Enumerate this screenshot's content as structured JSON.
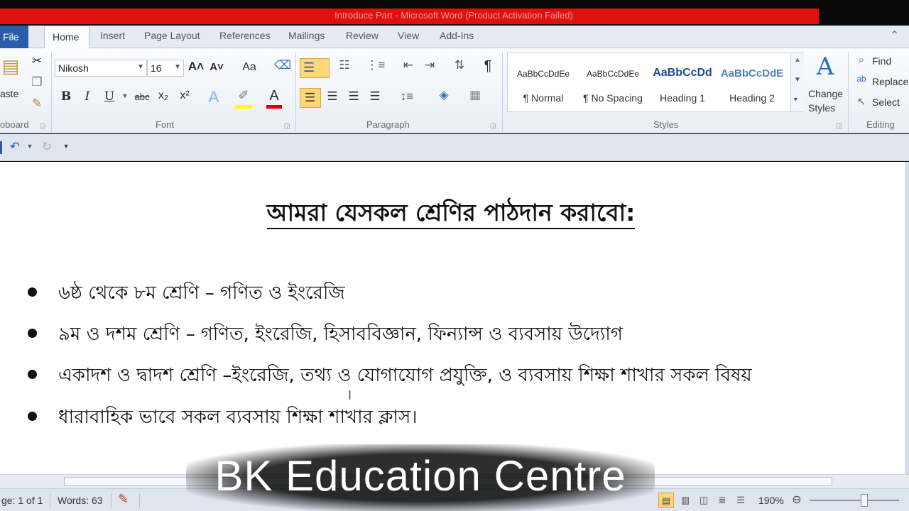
{
  "window": {
    "title": "Introduce Part - Microsoft Word (Product Activation Failed)"
  },
  "tabs": [
    "File",
    "Home",
    "Insert",
    "Page Layout",
    "References",
    "Mailings",
    "Review",
    "View",
    "Add-Ins"
  ],
  "clipboard": {
    "paste_label": "aste",
    "group_label": "oboard"
  },
  "font": {
    "name": "Nikosh",
    "size": "16",
    "group_label": "Font",
    "bold": "B",
    "italic": "I",
    "underline": "U",
    "strikethrough": "abc",
    "subscript": "x₂",
    "superscript": "x²",
    "grow": "A˄",
    "shrink": "A˅",
    "change_case": "Aa",
    "font_color_letter": "A"
  },
  "paragraph": {
    "group_label": "Paragraph",
    "pilcrow": "¶"
  },
  "styles": {
    "group_label": "Styles",
    "items": [
      {
        "preview": "AaBbCcDdEe",
        "name": "¶ Normal"
      },
      {
        "preview": "AaBbCcDdEe",
        "name": "¶ No Spacing"
      },
      {
        "preview": "AaBbCcDd",
        "name": "Heading 1"
      },
      {
        "preview": "AaBbCcDdE",
        "name": "Heading 2"
      }
    ],
    "change_styles_1": "Change",
    "change_styles_2": "Styles"
  },
  "editing": {
    "group_label": "Editing",
    "find": "Find",
    "replace": "Replace",
    "select": "Select"
  },
  "document": {
    "heading": "আমরা যেসকল শ্রেণির পাঠদান করাবো:",
    "bullets": [
      "৬ষ্ঠ থেকে ৮ম শ্রেণি – গণিত ও ইংরেজি",
      "৯ম ও দশম শ্রেণি – গণিত, ইংরেজি, হিসাববিজ্ঞান, ফিন্যান্স ও ব্যবসায় উদ্যোগ",
      "একাদশ ও দ্বাদশ শ্রেণি –ইংরেজি, তথ্য ও যোগাযোগ প্রযুক্তি, ও ব্যবসায় শিক্ষা শাখার সকল বিষয়",
      "ধারাবাহিক ভাবে সকল ব্যবসায় শিক্ষা শাখার ক্লাস।"
    ]
  },
  "status": {
    "page": "ge: 1 of 1",
    "words": "Words: 63",
    "zoom": "190%"
  },
  "overlay": {
    "text": "BK Education Centre"
  },
  "colors": {
    "title_bar": "#e0100f",
    "file_tab": "#2a5caa",
    "heading_style": "#1f4e8c"
  }
}
